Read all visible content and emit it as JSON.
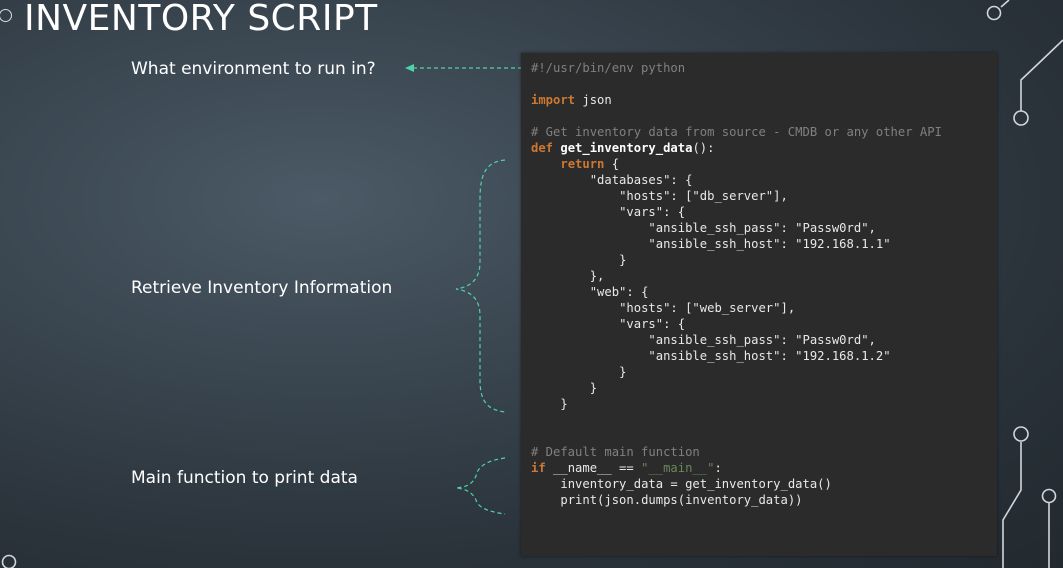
{
  "slide": {
    "title": "INVENTORY SCRIPT",
    "labels": {
      "environment": "What environment to run in?",
      "retrieve": "Retrieve Inventory Information",
      "main": "Main function to print data"
    }
  },
  "code": {
    "line1": "#!/usr/bin/env python",
    "l_import_kw": "import",
    "l_import_rest": " json",
    "line_comment1": "# Get inventory data from source - CMDB or any other API",
    "def_kw": "def",
    "def_name": "get_inventory_data",
    "def_rest": "():",
    "return_kw": "return",
    "return_rest": " {",
    "databases_key": "\"databases\": {",
    "db_hosts": "\"hosts\": [\"db_server\"],",
    "db_vars": "\"vars\": {",
    "db_pass": "\"ansible_ssh_pass\": \"Passw0rd\",",
    "db_host": "\"ansible_ssh_host\": \"192.168.1.1\"",
    "close1": "}",
    "close2": "},",
    "web_key": "\"web\": {",
    "web_hosts": "\"hosts\": [\"web_server\"],",
    "web_vars": "\"vars\": {",
    "web_pass": "\"ansible_ssh_pass\": \"Passw0rd\",",
    "web_host": "\"ansible_ssh_host\": \"192.168.1.2\"",
    "close3": "}",
    "close4": "}",
    "close5": "}",
    "comment2": "# Default main function",
    "if_kw": "if",
    "if_mid": " __name__ == ",
    "if_str": "\"__main__\"",
    "if_end": ":",
    "assign": "inventory_data = get_inventory_data()",
    "print_fn": "print",
    "print_rest": "(json.dumps(inventory_data))"
  },
  "colors": {
    "accent": "#4fd3a8",
    "keyword": "#cc7832",
    "code_bg": "#2b2b2b"
  }
}
